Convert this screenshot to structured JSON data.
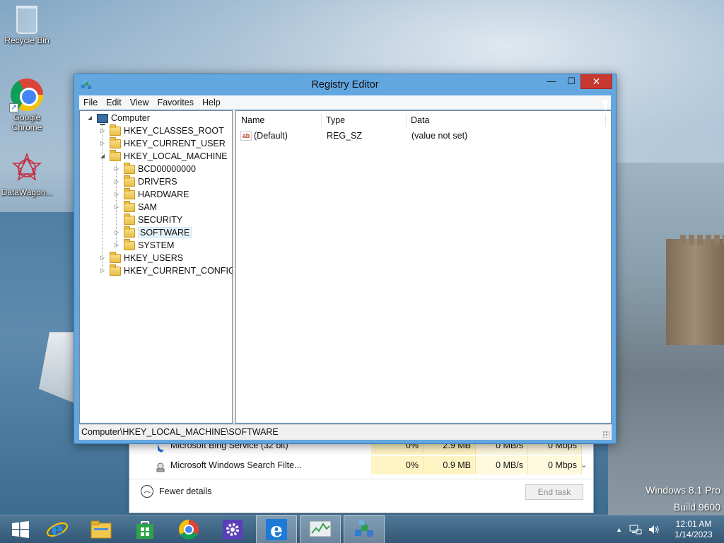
{
  "desktop": {
    "icons": [
      {
        "label": "Recycle Bin",
        "icon": "recycle-bin-icon"
      },
      {
        "label": "Google Chrome",
        "icon": "chrome-icon"
      },
      {
        "label": "DataWagon...",
        "icon": "datawagon-icon"
      }
    ],
    "watermark": {
      "line1": "Windows 8.1 Pro",
      "line2": "Build 9600"
    }
  },
  "task_manager": {
    "rows": [
      {
        "name": "Microsoft Bing Service (32 bit)",
        "cpu": "0%",
        "memory": "2.9 MB",
        "disk": "0 MB/s",
        "network": "0 Mbps"
      },
      {
        "name": "Microsoft Windows Search Filte...",
        "cpu": "0%",
        "memory": "0.9 MB",
        "disk": "0 MB/s",
        "network": "0 Mbps"
      }
    ],
    "fewer_details": "Fewer details",
    "end_task": "End task"
  },
  "regedit": {
    "title": "Registry Editor",
    "controls": {
      "minimize": "—",
      "maximize": "☐",
      "close": "✕"
    },
    "menu": [
      "File",
      "Edit",
      "View",
      "Favorites",
      "Help"
    ],
    "tree": {
      "root": "Computer",
      "hives": [
        "HKEY_CLASSES_ROOT",
        "HKEY_CURRENT_USER",
        "HKEY_LOCAL_MACHINE"
      ],
      "hklm_children": [
        "BCD00000000",
        "DRIVERS",
        "HARDWARE",
        "SAM",
        "SECURITY",
        "SOFTWARE",
        "SYSTEM"
      ],
      "more_hives": [
        "HKEY_USERS",
        "HKEY_CURRENT_CONFIG"
      ]
    },
    "columns": {
      "name": "Name",
      "type": "Type",
      "data": "Data"
    },
    "values": [
      {
        "name": "(Default)",
        "type": "REG_SZ",
        "data": "(value not set)"
      }
    ],
    "status_path": "Computer\\HKEY_LOCAL_MACHINE\\SOFTWARE"
  },
  "taskbar": {
    "apps": [
      {
        "icon": "start-icon",
        "active": false
      },
      {
        "icon": "internet-explorer-icon",
        "active": false
      },
      {
        "icon": "file-explorer-icon",
        "active": false
      },
      {
        "icon": "store-icon",
        "active": false
      },
      {
        "icon": "chrome-icon",
        "active": false
      },
      {
        "icon": "settings-icon",
        "active": false
      },
      {
        "icon": "internet-explorer-icon",
        "active": true
      },
      {
        "icon": "task-manager-icon",
        "active": true
      },
      {
        "icon": "regedit-icon",
        "active": true
      }
    ],
    "time": "12:01 AM",
    "date": "1/14/2023"
  }
}
